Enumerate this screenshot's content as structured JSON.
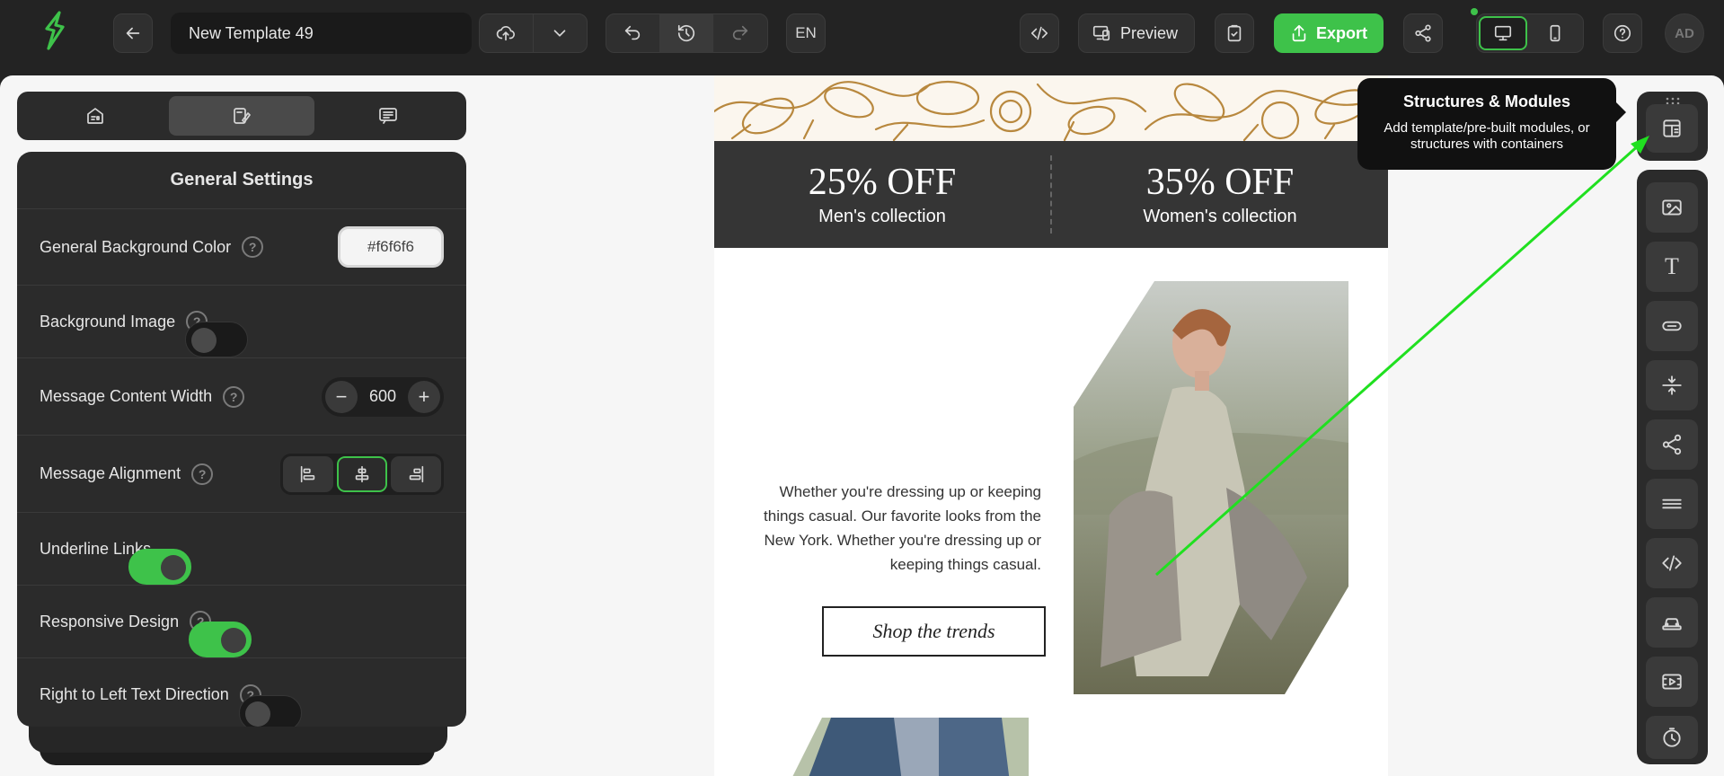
{
  "topbar": {
    "template_name": "New Template 49",
    "language": "EN",
    "preview_label": "Preview",
    "export_label": "Export",
    "avatar_initials": "AD",
    "accent_color": "#3ec24a"
  },
  "side_tabs": [
    {
      "icon": "content-icon"
    },
    {
      "icon": "style-icon",
      "active": true
    },
    {
      "icon": "comments-icon"
    }
  ],
  "settings": {
    "title": "General Settings",
    "background_color_label": "General Background Color",
    "background_color_value": "#f6f6f6",
    "background_image_label": "Background Image",
    "background_image_on": false,
    "content_width_label": "Message Content Width",
    "content_width_value": "600",
    "alignment_label": "Message Alignment",
    "alignment_value": "center",
    "underline_links_label": "Underline Links",
    "underline_links_on": true,
    "responsive_label": "Responsive Design",
    "responsive_on": true,
    "rtl_label": "Right to Left Text Direction",
    "rtl_on": false
  },
  "email": {
    "offer1_pct": "25% OFF",
    "offer1_sub": "Men's collection",
    "offer2_pct": "35% OFF",
    "offer2_sub": "Women's collection",
    "body_text": "Whether you're dressing up or keeping things casual. Our favorite looks from the New York. Whether you're dressing up or keeping things casual.",
    "cta_label": "Shop the trends"
  },
  "tooltip": {
    "title": "Structures & Modules",
    "body": "Add template/pre-built modules, or structures with containers"
  },
  "right_tools": [
    "modules-icon",
    "image-icon",
    "text-icon",
    "button-icon",
    "spacer-icon",
    "social-icon",
    "menu-icon",
    "html-icon",
    "banner-icon",
    "video-icon",
    "timer-icon"
  ]
}
